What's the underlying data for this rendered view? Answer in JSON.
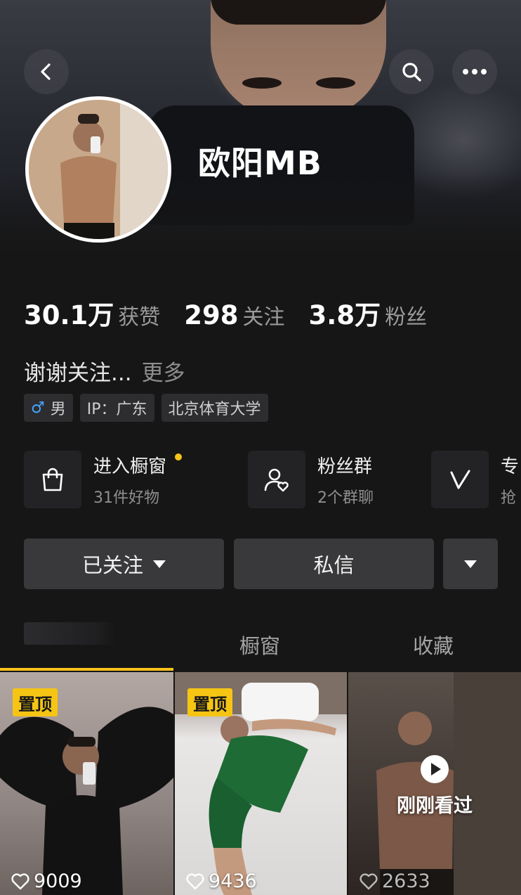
{
  "profile": {
    "name": "欧阳MB",
    "stats": {
      "likes_value": "30.1万",
      "likes_label": "获赞",
      "following_value": "298",
      "following_label": "关注",
      "followers_value": "3.8万",
      "followers_label": "粉丝"
    },
    "bio": "谢谢关注...",
    "bio_more": "更多",
    "tags": {
      "gender_symbol": "♂",
      "gender": "男",
      "ip": "IP：广东",
      "school": "北京体育大学"
    }
  },
  "features": [
    {
      "title": "进入橱窗",
      "subtitle": "31件好物",
      "icon": "shopping-bag-icon"
    },
    {
      "title": "粉丝群",
      "subtitle": "2个群聊",
      "icon": "fan-group-icon"
    },
    {
      "title": "专",
      "subtitle": "抢",
      "icon": "v-icon"
    }
  ],
  "actions": {
    "follow": "已关注",
    "message": "私信"
  },
  "tabs": {
    "showcase": "橱窗",
    "favorites": "收藏"
  },
  "videos": [
    {
      "pin": "置顶",
      "likes": "9009"
    },
    {
      "pin": "置顶",
      "likes": "9436"
    },
    {
      "watched": "刚刚看过",
      "likes": "2633"
    }
  ],
  "colors": {
    "accent": "#f7c21a",
    "background": "#161616",
    "button": "#39393b"
  }
}
